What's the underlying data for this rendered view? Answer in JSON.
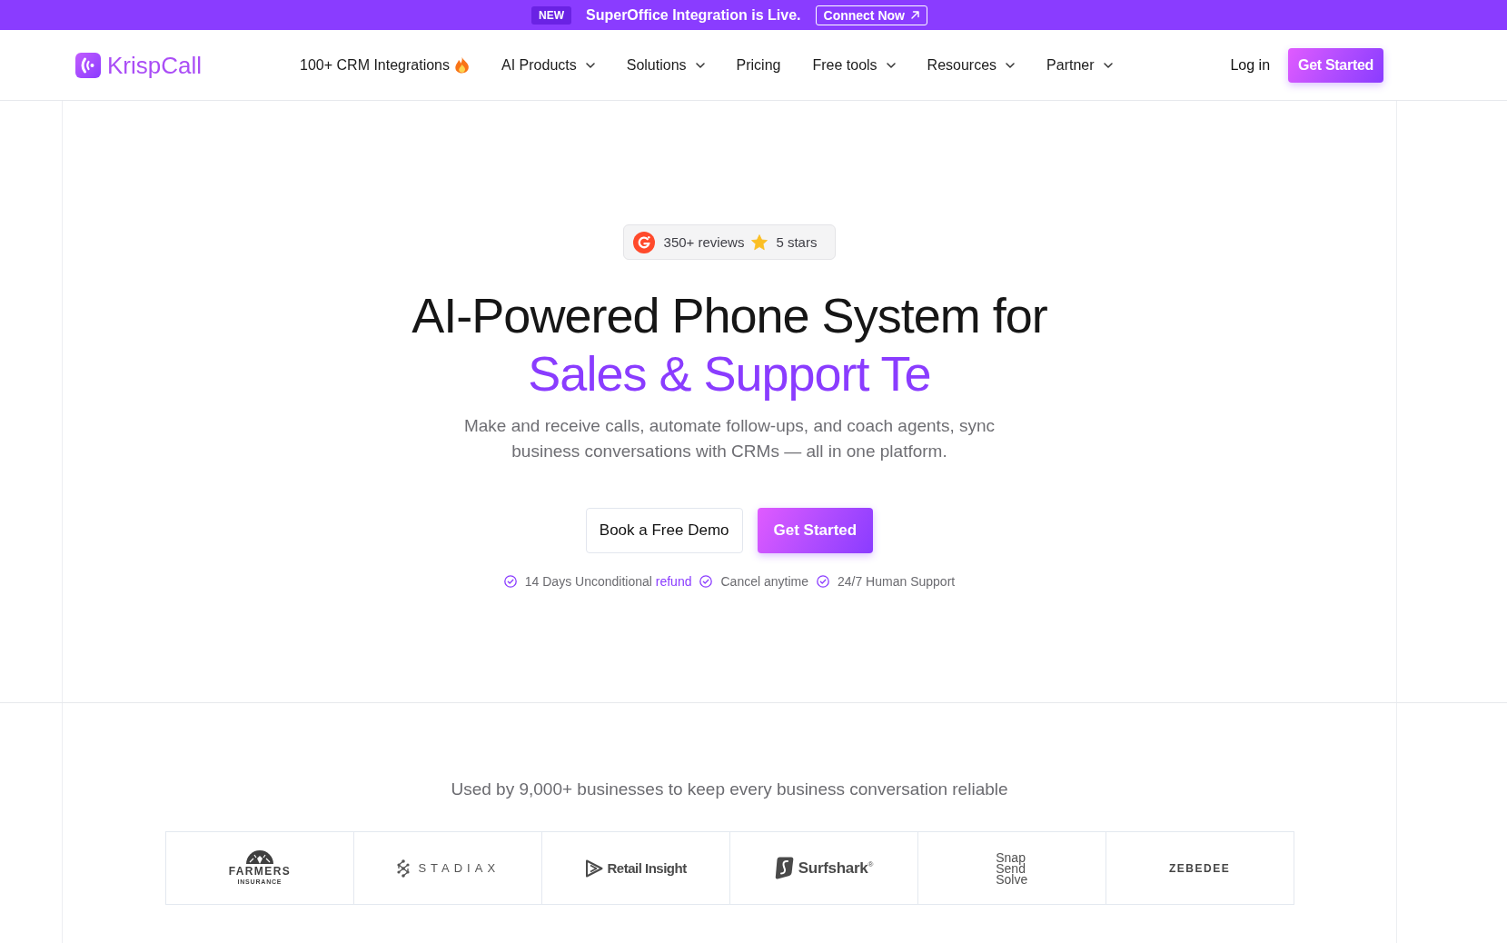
{
  "announcement_bar": {
    "badge": "NEW",
    "message": "SuperOffice Integration is Live.",
    "button": "Connect Now"
  },
  "header": {
    "logo": "KrispCall",
    "nav": [
      {
        "label": "100+ CRM Integrations",
        "kind": "featured"
      },
      {
        "label": "AI Products",
        "kind": "menu"
      },
      {
        "label": "Solutions",
        "kind": "menu"
      },
      {
        "label": "Pricing",
        "kind": "link"
      },
      {
        "label": "Free tools",
        "kind": "menu"
      },
      {
        "label": "Resources",
        "kind": "menu"
      },
      {
        "label": "Partner",
        "kind": "menu"
      }
    ],
    "login": "Log in",
    "cta": "Get Started"
  },
  "hero": {
    "rating_badge": {
      "reviews": "350+ reviews",
      "rating": "5 stars"
    },
    "title": "AI-Powered Phone System for",
    "title_highlight": "Sales & Support Te",
    "subtitle": "Make and receive calls, automate follow-ups, and coach agents, sync business conversations with CRMs — all in one platform.",
    "buttons": [
      {
        "label": "Book a Free Demo",
        "kind": "secondary"
      },
      {
        "label": "Get Started",
        "kind": "primary"
      }
    ],
    "assurances": [
      {
        "text": "14 Days Unconditional",
        "link": "refund"
      },
      {
        "text": "Cancel anytime"
      },
      {
        "text": "24/7 Human Support"
      }
    ]
  },
  "customers": {
    "caption": "Used by 9,000+ businesses to keep every business conversation reliable",
    "logos": [
      {
        "kind": "farmers",
        "lines": [
          "FARMERS",
          "INSURANCE"
        ]
      },
      {
        "kind": "stadiax",
        "lines": [
          "STADIAX"
        ]
      },
      {
        "kind": "retail",
        "lines": [
          "Retail Insight"
        ]
      },
      {
        "kind": "surfshark",
        "lines": [
          "Surfshark$^{®}$"
        ]
      },
      {
        "kind": "stacked",
        "lines": [
          "Snap",
          "Send",
          "Solve"
        ]
      },
      {
        "kind": "zebedee",
        "lines": [
          "ZEBEDEE"
        ]
      }
    ]
  }
}
